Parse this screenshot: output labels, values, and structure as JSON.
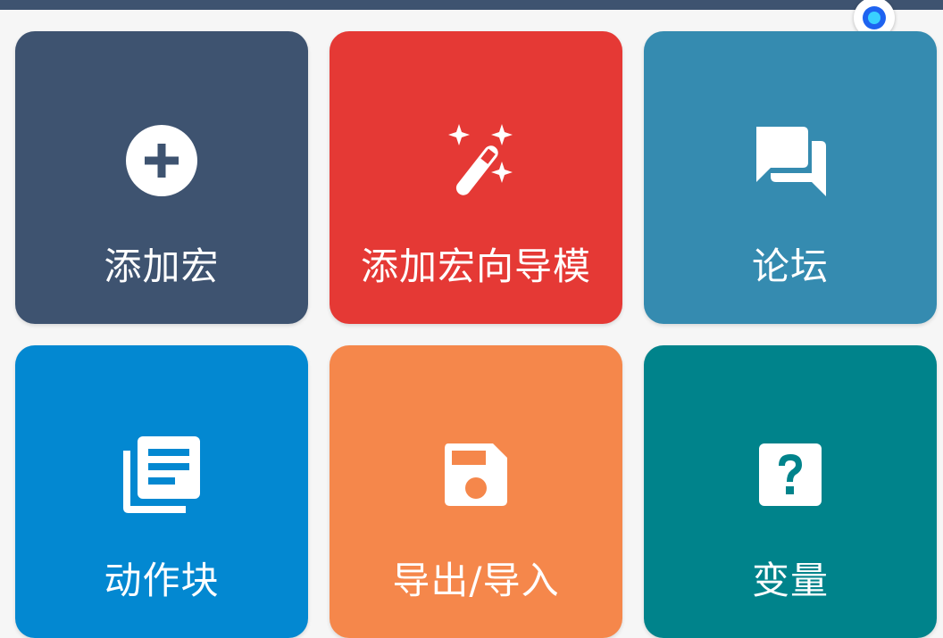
{
  "colors": {
    "topbar": "#3e5370",
    "tile_add_macro": "#3e5370",
    "tile_wizard": "#e53935",
    "tile_forum": "#358bb0",
    "tile_action_blocks": "#0388d1",
    "tile_export_import": "#f5874b",
    "tile_variables": "#00838b"
  },
  "tiles": [
    {
      "label": "添加宏",
      "icon": "add-circle-icon"
    },
    {
      "label": "添加宏向导模",
      "icon": "magic-wand-icon"
    },
    {
      "label": "论坛",
      "icon": "forum-chat-icon"
    },
    {
      "label": "动作块",
      "icon": "library-books-icon"
    },
    {
      "label": "导出/导入",
      "icon": "floppy-disk-icon"
    },
    {
      "label": "变量",
      "icon": "question-box-icon"
    }
  ]
}
